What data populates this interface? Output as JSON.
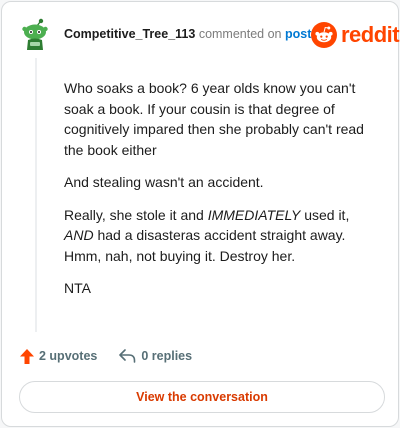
{
  "comment": {
    "username": "Competitive_Tree_113",
    "commented_text": "commented on",
    "post_link": "post",
    "paragraphs": {
      "p1": "Who soaks a book? 6 year olds know you can't soak a book. If your cousin is that degree of cognitively impared then she probably can't read the book either",
      "p2": "And stealing wasn't an accident.",
      "p3_a": "Really, she stole it and ",
      "p3_em1": "IMMEDIATELY",
      "p3_b": " used it, ",
      "p3_em2": "AND",
      "p3_c": " had a disasteras accident straight away. Hmm, nah, not buying it. Destroy her.",
      "p4": "NTA"
    }
  },
  "brand": {
    "wordmark": "reddit",
    "color": "#ff4500"
  },
  "actions": {
    "upvotes": "2 upvotes",
    "replies": "0 replies"
  },
  "cta": {
    "label": "View the conversation"
  },
  "colors": {
    "accent": "#ff4500",
    "link": "#0079d3",
    "cta_text": "#d93a00"
  },
  "icons": [
    "snoo-avatar-icon",
    "reddit-logo-icon",
    "upvote-arrow-icon",
    "reply-arrow-icon"
  ]
}
